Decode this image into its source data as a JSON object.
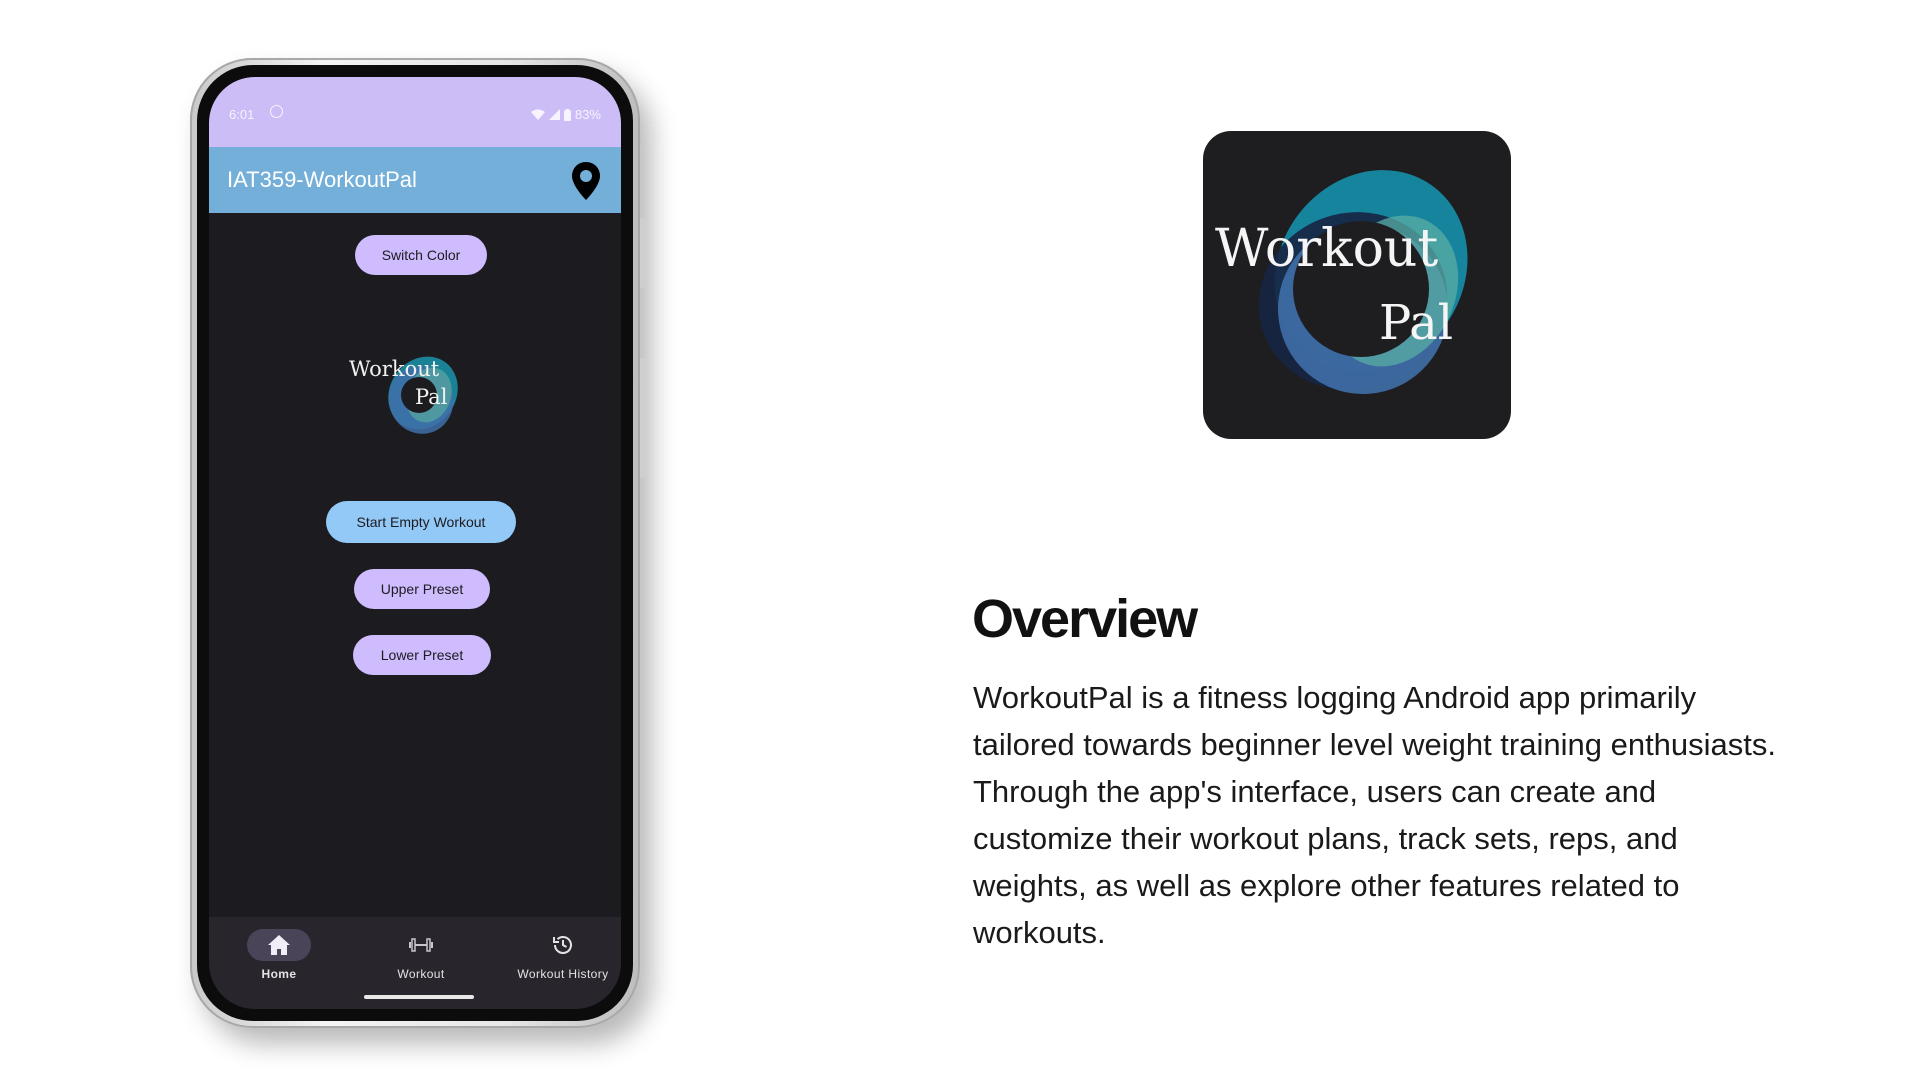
{
  "phone": {
    "status_bar": {
      "time": "6:01",
      "battery": "83%"
    },
    "app_bar": {
      "title": "IAT359-WorkoutPal",
      "action_icon": "location-pin-icon"
    },
    "buttons": {
      "switch_color": "Switch Color",
      "start_empty_workout": "Start Empty Workout",
      "upper_preset": "Upper Preset",
      "lower_preset": "Lower Preset"
    },
    "logo": {
      "line1": "Workout",
      "line2": "Pal"
    },
    "bottom_nav": [
      {
        "label": "Home",
        "icon": "home-icon",
        "active": true
      },
      {
        "label": "Workout",
        "icon": "dumbbell-icon",
        "active": false
      },
      {
        "label": "Workout History",
        "icon": "history-icon",
        "active": false
      }
    ]
  },
  "app_icon": {
    "line1": "Workout",
    "line2": "Pal"
  },
  "overview": {
    "title": "Overview",
    "body": "WorkoutPal is a fitness logging Android app primarily tailored towards beginner level weight training enthusiasts. Through the app's interface, users can create and customize their workout plans, track sets, reps, and weights, as well as explore other features related to workouts."
  },
  "colors": {
    "status_bar": "#cdbdf7",
    "app_bar": "#74afd9",
    "screen_bg": "#1c1b1f",
    "button_purple": "#cfbcfe",
    "button_blue": "#93c9f6",
    "nav_bg": "#28262c"
  }
}
